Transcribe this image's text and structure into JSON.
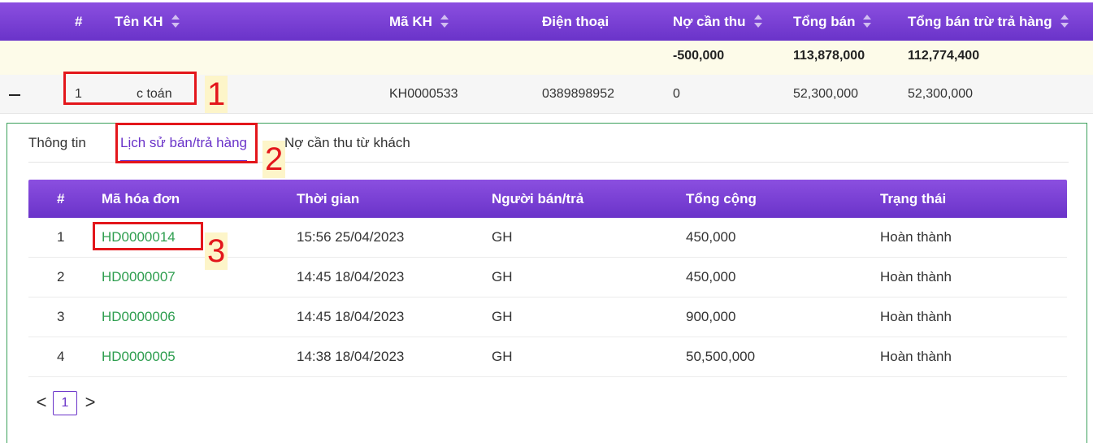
{
  "main_table": {
    "columns": [
      {
        "key": "index",
        "label": "#",
        "sortable": false
      },
      {
        "key": "name",
        "label": "Tên KH",
        "sortable": true
      },
      {
        "key": "code",
        "label": "Mã KH",
        "sortable": true
      },
      {
        "key": "phone",
        "label": "Điện thoại",
        "sortable": false
      },
      {
        "key": "debt",
        "label": "Nợ cần thu",
        "sortable": true
      },
      {
        "key": "total_sales",
        "label": "Tổng bán",
        "sortable": true
      },
      {
        "key": "net_sales",
        "label": "Tổng bán trừ trả hàng",
        "sortable": true
      }
    ],
    "summary": {
      "debt": "-500,000",
      "total_sales": "113,878,000",
      "net_sales": "112,774,400"
    },
    "rows": [
      {
        "index": "1",
        "name": "c toán",
        "code": "KH0000533",
        "phone": "0389898952",
        "debt": "0",
        "total_sales": "52,300,000",
        "net_sales": "52,300,000"
      }
    ]
  },
  "tabs": [
    {
      "label": "Thông tin",
      "active": false
    },
    {
      "label": "Lịch sử bán/trả hàng",
      "active": true
    },
    {
      "label": "Nợ cần thu từ khách",
      "active": false
    }
  ],
  "invoice_table": {
    "columns": [
      "#",
      "Mã hóa đơn",
      "Thời gian",
      "Người bán/trả",
      "Tổng cộng",
      "Trạng thái"
    ],
    "rows": [
      {
        "index": "1",
        "invoice": "HD0000014",
        "time": "15:56 25/04/2023",
        "seller": "GH",
        "total": "450,000",
        "status": "Hoàn thành"
      },
      {
        "index": "2",
        "invoice": "HD0000007",
        "time": "14:45 18/04/2023",
        "seller": "GH",
        "total": "450,000",
        "status": "Hoàn thành"
      },
      {
        "index": "3",
        "invoice": "HD0000006",
        "time": "14:45 18/04/2023",
        "seller": "GH",
        "total": "900,000",
        "status": "Hoàn thành"
      },
      {
        "index": "4",
        "invoice": "HD0000005",
        "time": "14:38 18/04/2023",
        "seller": "GH",
        "total": "50,500,000",
        "status": "Hoàn thành"
      }
    ]
  },
  "pagination": {
    "prev": "<",
    "current": "1",
    "next": ">"
  },
  "annotations": [
    "1",
    "2",
    "3"
  ],
  "colors": {
    "header_purple": "#7b3fd6",
    "link_green": "#2e9e4f",
    "annotation_red": "#e3161b",
    "panel_border": "#3aa05a"
  }
}
